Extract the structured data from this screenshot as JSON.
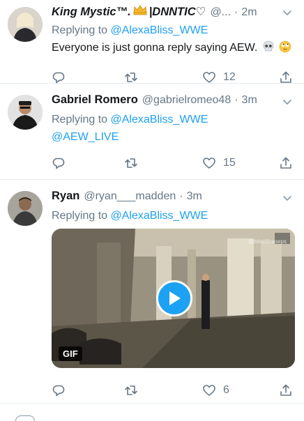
{
  "tweets": [
    {
      "name": "King Mystic™.",
      "name_suffix": "|DNNTIC♡",
      "handle": "@...",
      "time": "2m",
      "replying_prefix": "Replying to",
      "replying_to": "@AlexaBliss_WWE",
      "text": "Everyone is just gonna reply saying AEW.",
      "emoji_names": [
        "skull-icon",
        "rolling-eyes-icon"
      ],
      "likes": "12"
    },
    {
      "name": "Gabriel Romero",
      "handle": "@gabrielromeo48",
      "time": "3m",
      "replying_prefix": "Replying to",
      "replying_to": "@AlexaBliss_WWE",
      "text": "@AEW_LIVE",
      "likes": "15"
    },
    {
      "name": "Ryan",
      "handle": "@ryan___madden",
      "time": "3m",
      "replying_prefix": "Replying to",
      "replying_to": "@AlexaBliss_WWE",
      "media": {
        "badge": "GIF",
        "watermark": "@totaldivaseps"
      },
      "likes": "6"
    }
  ],
  "colors": {
    "link": "#1da1f2",
    "secondary_text": "#657786",
    "divider": "#e6ecf0"
  }
}
